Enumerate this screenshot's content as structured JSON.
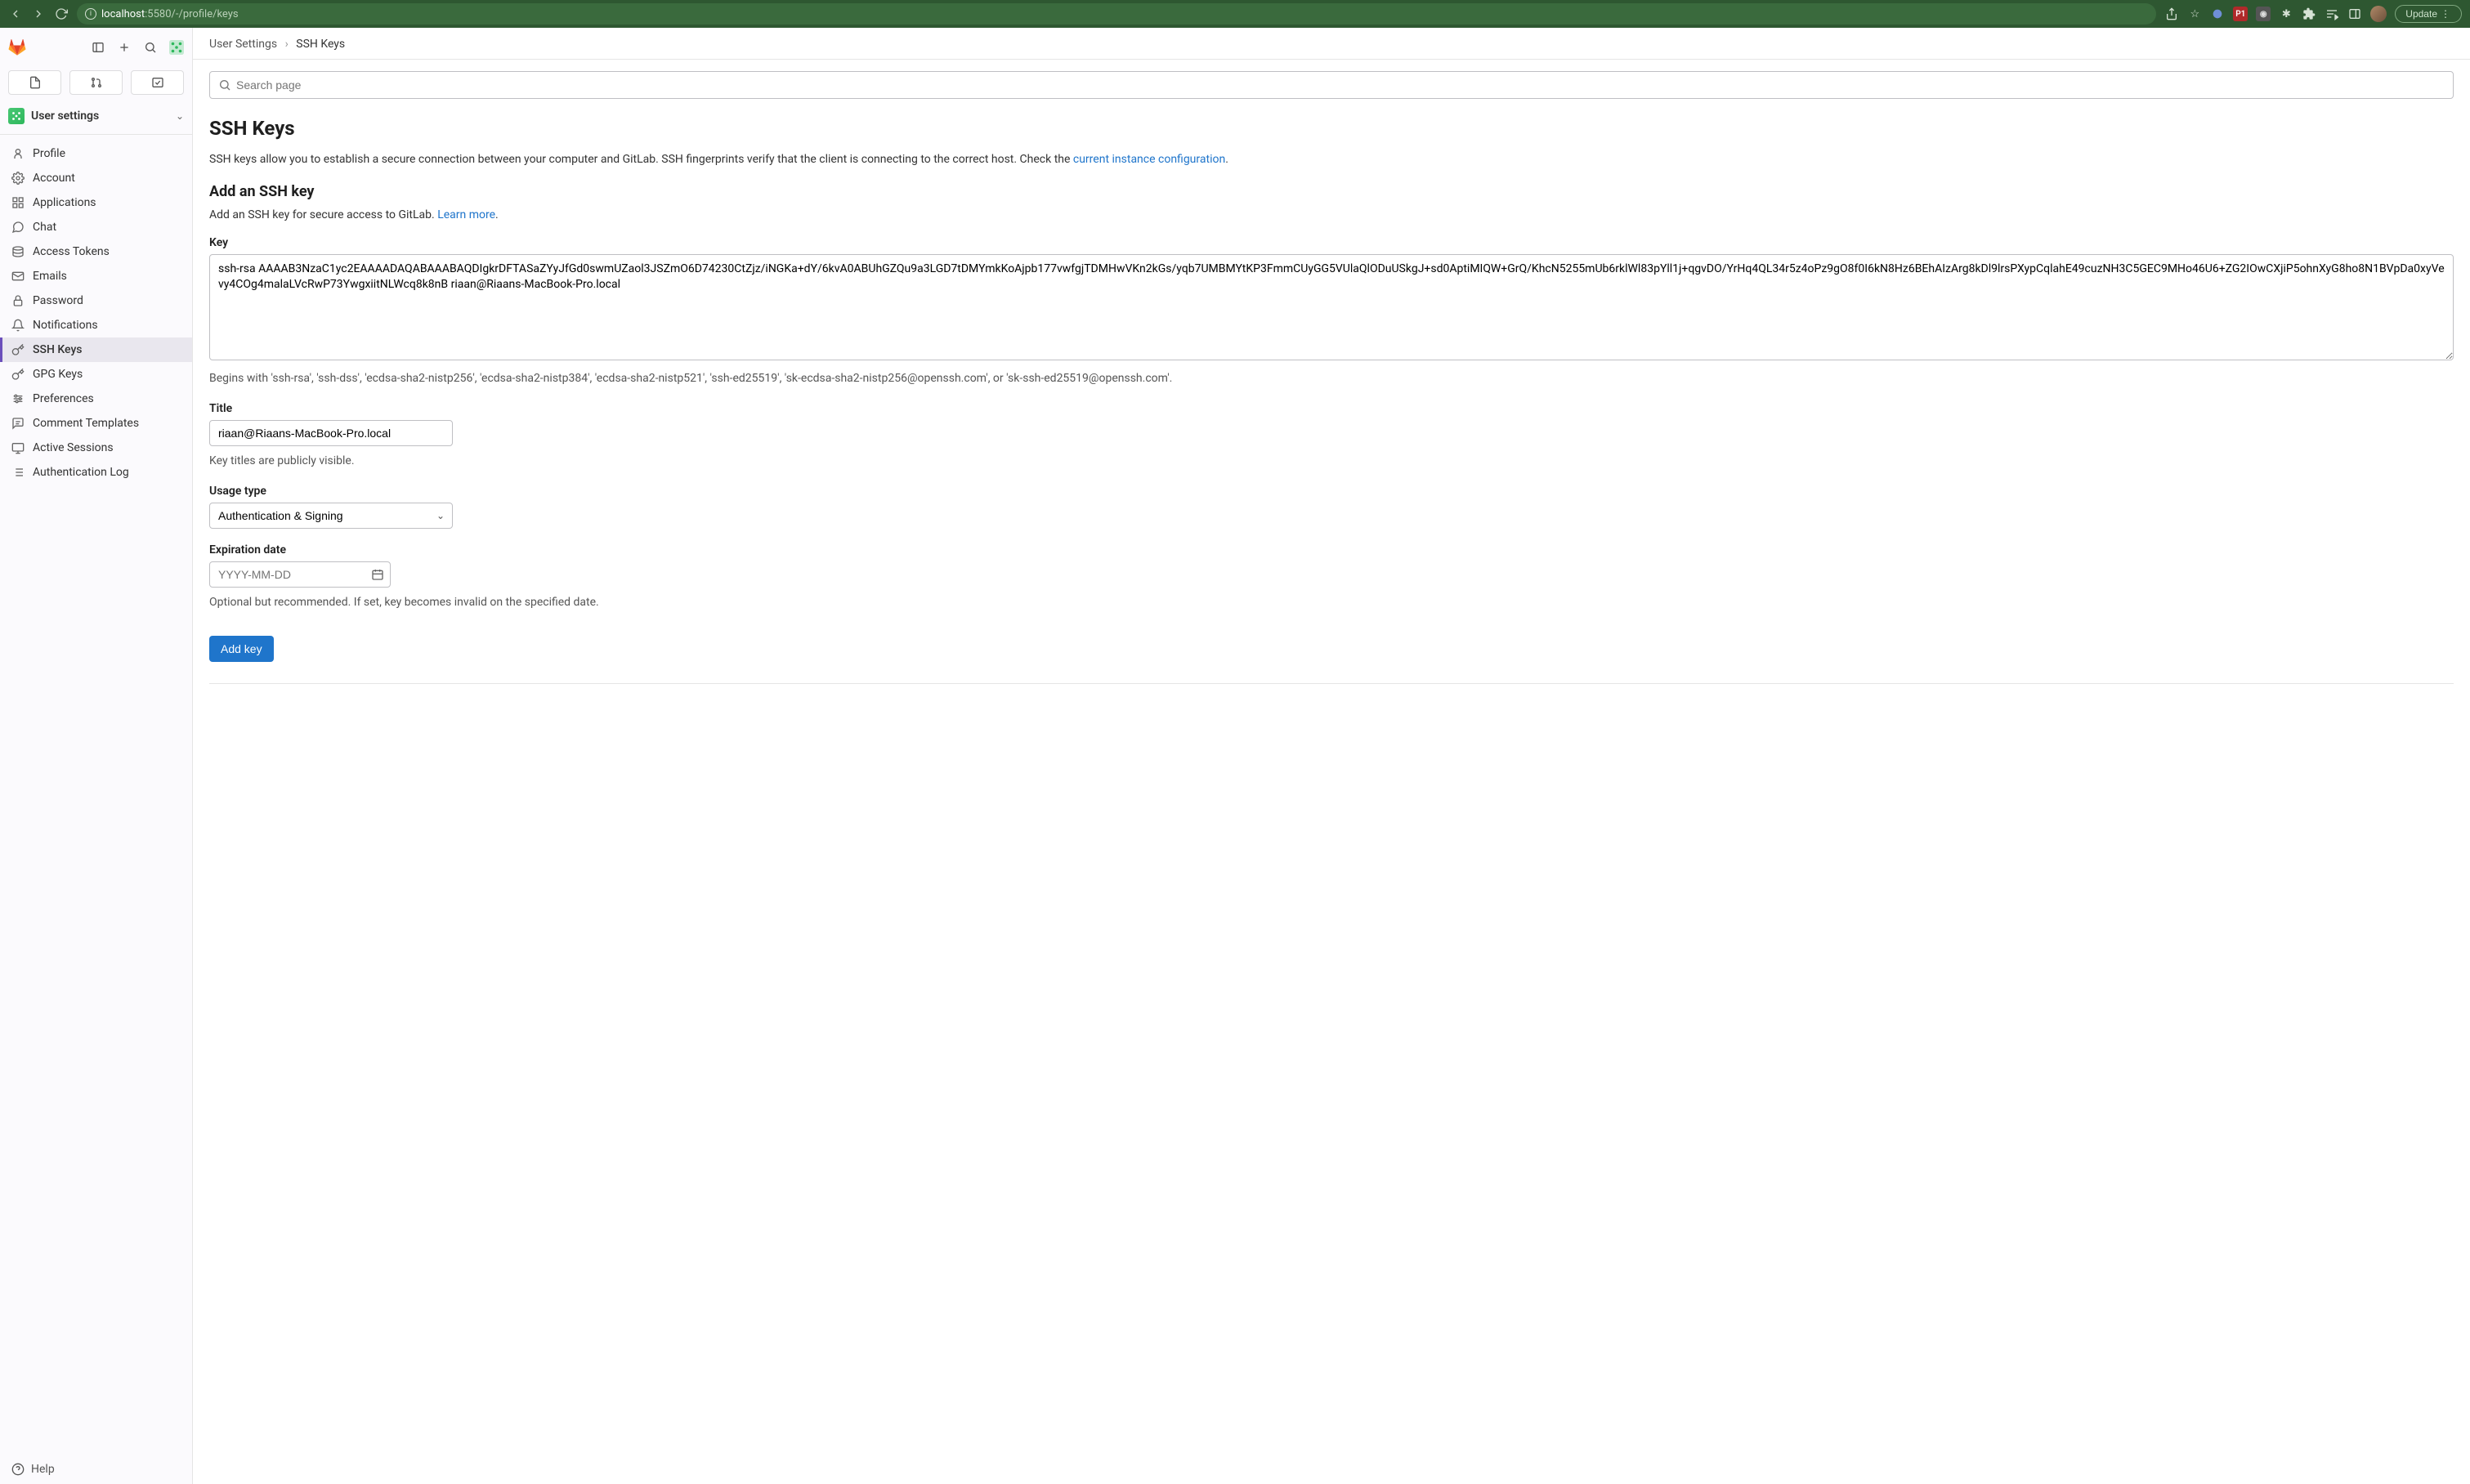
{
  "browser": {
    "url_host": "localhost",
    "url_port_path": ":5580/-/profile/keys",
    "update_label": "Update"
  },
  "sidebar": {
    "header_label": "User settings",
    "items": [
      {
        "label": "Profile"
      },
      {
        "label": "Account"
      },
      {
        "label": "Applications"
      },
      {
        "label": "Chat"
      },
      {
        "label": "Access Tokens"
      },
      {
        "label": "Emails"
      },
      {
        "label": "Password"
      },
      {
        "label": "Notifications"
      },
      {
        "label": "SSH Keys"
      },
      {
        "label": "GPG Keys"
      },
      {
        "label": "Preferences"
      },
      {
        "label": "Comment Templates"
      },
      {
        "label": "Active Sessions"
      },
      {
        "label": "Authentication Log"
      }
    ],
    "help_label": "Help"
  },
  "breadcrumb": {
    "root": "User Settings",
    "current": "SSH Keys"
  },
  "search": {
    "placeholder": "Search page"
  },
  "page": {
    "title": "SSH Keys",
    "intro_pre": "SSH keys allow you to establish a secure connection between your computer and GitLab. SSH fingerprints verify that the client is connecting to the correct host. Check the ",
    "intro_link": "current instance configuration",
    "intro_post": ".",
    "add_title": "Add an SSH key",
    "add_sub_pre": "Add an SSH key for secure access to GitLab. ",
    "add_sub_link": "Learn more",
    "add_sub_post": ".",
    "key_label": "Key",
    "key_value": "ssh-rsa AAAAB3NzaC1yc2EAAAADAQABAAABAQDIgkrDFTASaZYyJfGd0swmUZaol3JSZmO6D74230CtZjz/iNGKa+dY/6kvA0ABUhGZQu9a3LGD7tDMYmkKoAjpb177vwfgjTDMHwVKn2kGs/yqb7UMBMYtKP3FmmCUyGG5VUlaQlODuUSkgJ+sd0AptiMIQW+GrQ/KhcN5255mUb6rklWl83pYll1j+qgvDO/YrHq4QL34r5z4oPz9gO8f0I6kN8Hz6BEhAIzArg8kDl9lrsPXypCqlahE49cuzNH3C5GEC9MHo46U6+ZG2IOwCXjiP5ohnXyG8ho8N1BVpDa0xyVevy4COg4malaLVcRwP73YwgxiitNLWcq8k8nB riaan@Riaans-MacBook-Pro.local",
    "key_helper": "Begins with 'ssh-rsa', 'ssh-dss', 'ecdsa-sha2-nistp256', 'ecdsa-sha2-nistp384', 'ecdsa-sha2-nistp521', 'ssh-ed25519', 'sk-ecdsa-sha2-nistp256@openssh.com', or 'sk-ssh-ed25519@openssh.com'.",
    "title_label": "Title",
    "title_value": "riaan@Riaans-MacBook-Pro.local",
    "title_helper": "Key titles are publicly visible.",
    "usage_label": "Usage type",
    "usage_value": "Authentication & Signing",
    "expiry_label": "Expiration date",
    "expiry_placeholder": "YYYY-MM-DD",
    "expiry_helper": "Optional but recommended. If set, key becomes invalid on the specified date.",
    "submit_label": "Add key"
  }
}
